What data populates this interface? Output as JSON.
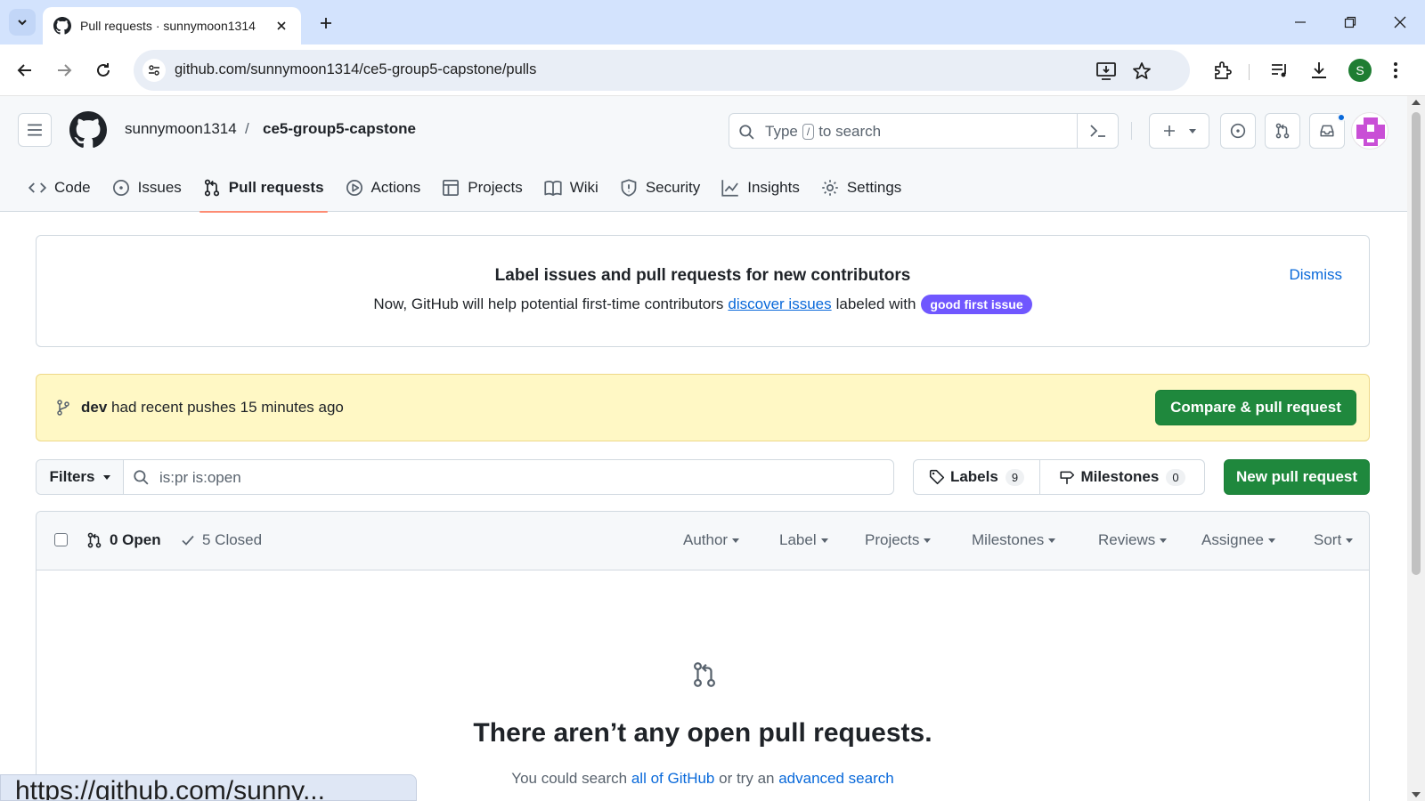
{
  "browser": {
    "tab_title": "Pull requests · sunnymoon1314",
    "url": "github.com/sunnymoon1314/ce5-group5-capstone/pulls",
    "profile_initial": "S",
    "status_url": "https://github.com/sunny..."
  },
  "header": {
    "owner": "sunnymoon1314",
    "separator": "/",
    "repo": "ce5-group5-capstone",
    "search_prefix": "Type",
    "search_key": "/",
    "search_suffix": "to search"
  },
  "repo_nav": {
    "code": "Code",
    "issues": "Issues",
    "pull_requests": "Pull requests",
    "actions": "Actions",
    "projects": "Projects",
    "wiki": "Wiki",
    "security": "Security",
    "insights": "Insights",
    "settings": "Settings"
  },
  "banner": {
    "title": "Label issues and pull requests for new contributors",
    "text_before": "Now, GitHub will help potential first-time contributors",
    "link": "discover issues",
    "text_after": "labeled with",
    "label": "good first issue",
    "label_color": "#7057ff",
    "dismiss": "Dismiss"
  },
  "flash": {
    "branch": "dev",
    "message": "had recent pushes 15 minutes ago",
    "button": "Compare & pull request"
  },
  "filters": {
    "button": "Filters",
    "query": "is:pr is:open",
    "labels": "Labels",
    "labels_count": "9",
    "milestones": "Milestones",
    "milestones_count": "0",
    "new_pr": "New pull request"
  },
  "list": {
    "open": "0 Open",
    "closed": "5 Closed",
    "author": "Author",
    "label": "Label",
    "projects": "Projects",
    "milestones": "Milestones",
    "reviews": "Reviews",
    "assignee": "Assignee",
    "sort": "Sort",
    "blank_title": "There aren’t any open pull requests.",
    "blank_sub_1": "You could search",
    "blank_link_1": "all of GitHub",
    "blank_sub_2": "or try an",
    "blank_link_2": "advanced search"
  },
  "colors": {
    "accent_green": "#1f883d",
    "link_blue": "#0969da",
    "active_underline": "#fd8c73",
    "flash_bg": "#fff8c5"
  }
}
